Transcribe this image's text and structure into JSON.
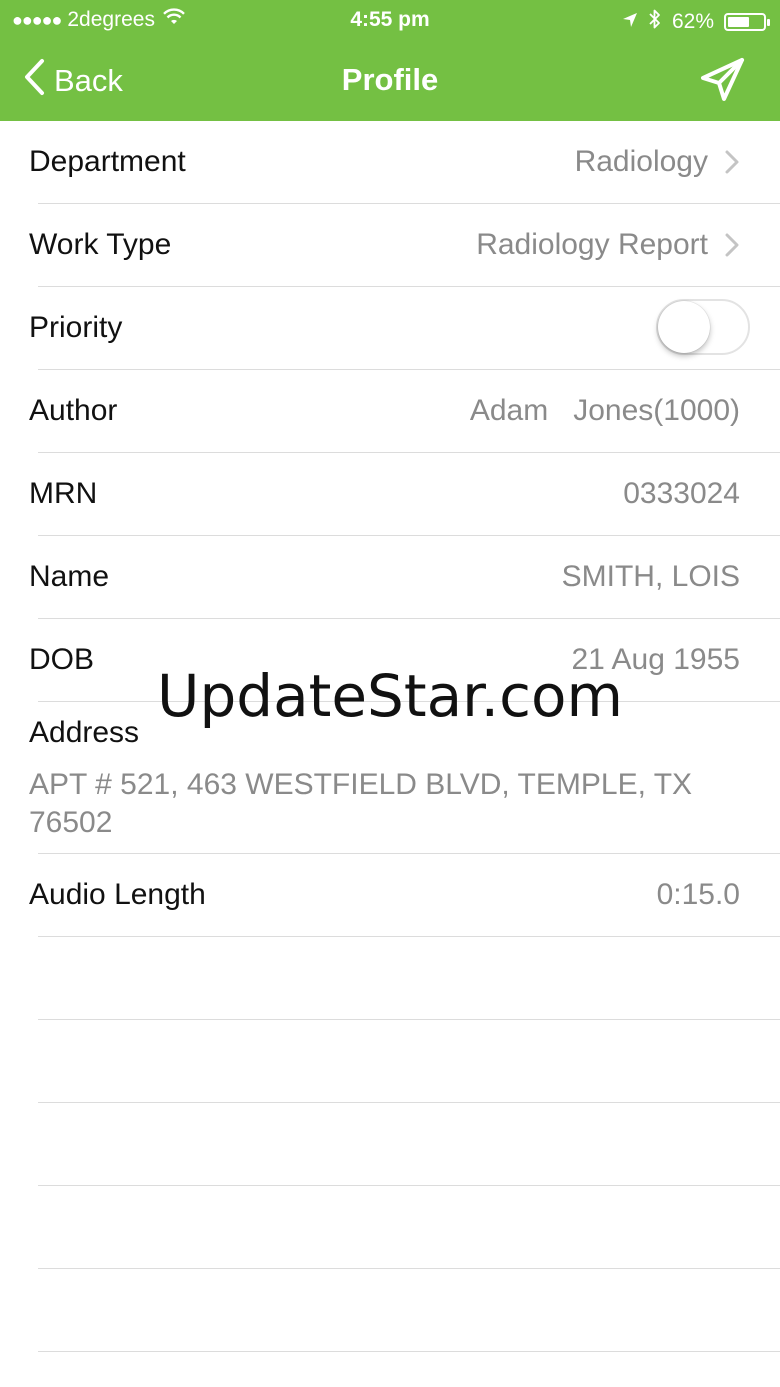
{
  "status_bar": {
    "signal_dots": "●●●●●",
    "carrier": "2degrees",
    "time": "4:55 pm",
    "battery_percent": "62%",
    "battery_level": 0.62
  },
  "nav": {
    "back_label": "Back",
    "title": "Profile",
    "action_icon": "send-icon"
  },
  "rows": {
    "department": {
      "label": "Department",
      "value": "Radiology"
    },
    "work_type": {
      "label": "Work Type",
      "value": "Radiology Report"
    },
    "priority": {
      "label": "Priority",
      "on": false
    },
    "author": {
      "label": "Author",
      "value": "Adam   Jones(1000)"
    },
    "mrn": {
      "label": "MRN",
      "value": "0333024"
    },
    "name": {
      "label": "Name",
      "value": "SMITH, LOIS"
    },
    "dob": {
      "label": "DOB",
      "value": "21 Aug 1955"
    },
    "address": {
      "label": "Address",
      "value": "APT # 521, 463 WESTFIELD BLVD, TEMPLE, TX 76502"
    },
    "audio_length": {
      "label": "Audio Length",
      "value": "0:15.0"
    }
  },
  "watermark": "UpdateStar.com",
  "colors": {
    "accent": "#74c043",
    "value_text": "#8a8a8a",
    "separator": "#dcdcdc"
  }
}
